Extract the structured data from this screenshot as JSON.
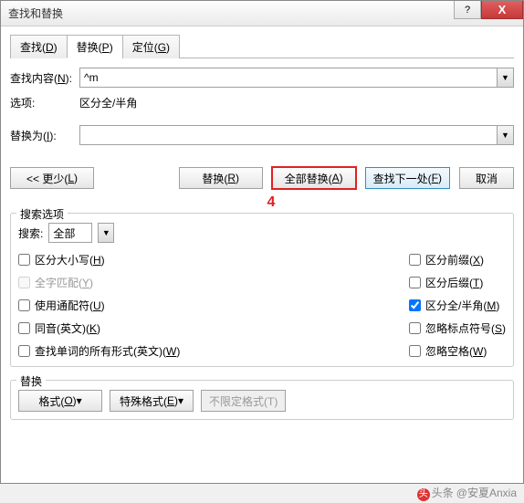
{
  "window": {
    "title": "查找和替换"
  },
  "titlebar_buttons": {
    "help": "?",
    "close": "X"
  },
  "tabs": {
    "find": {
      "label_pre": "查找(",
      "key": "D",
      "label_post": ")"
    },
    "replace": {
      "label_pre": "替换(",
      "key": "P",
      "label_post": ")"
    },
    "goto": {
      "label_pre": "定位(",
      "key": "G",
      "label_post": ")"
    }
  },
  "fields": {
    "find_label_pre": "查找内容(",
    "find_key": "N",
    "find_label_post": "):",
    "find_value": "^m",
    "options_label": "选项:",
    "options_value": "区分全/半角",
    "replace_label_pre": "替换为(",
    "replace_key": "I",
    "replace_label_post": "):",
    "replace_value": ""
  },
  "buttons": {
    "less": "<< 更少(",
    "less_key": "L",
    "less_post": ")",
    "replace": "替换(",
    "replace_key": "R",
    "replace_post": ")",
    "replace_all": "全部替换(",
    "replace_all_key": "A",
    "replace_all_post": ")",
    "find_next": "查找下一处(",
    "find_next_key": "F",
    "find_next_post": ")",
    "cancel": "取消",
    "format": "格式(",
    "format_key": "O",
    "format_post": ")",
    "special": "特殊格式(",
    "special_key": "E",
    "special_post": ")",
    "noformat": "不限定格式(T)"
  },
  "annotation": "4",
  "groups": {
    "search_options": "搜索选项",
    "replace_group": "替换"
  },
  "search_dir": {
    "label": "搜索:",
    "value": "全部"
  },
  "checkboxes_left": [
    {
      "pre": "区分大小写(",
      "key": "H",
      "post": ")",
      "checked": false,
      "disabled": false
    },
    {
      "pre": "全字匹配(",
      "key": "Y",
      "post": ")",
      "checked": false,
      "disabled": true
    },
    {
      "pre": "使用通配符(",
      "key": "U",
      "post": ")",
      "checked": false,
      "disabled": false
    },
    {
      "pre": "同音(英文)(",
      "key": "K",
      "post": ")",
      "checked": false,
      "disabled": false
    },
    {
      "pre": "查找单词的所有形式(英文)(",
      "key": "W",
      "post": ")",
      "checked": false,
      "disabled": false
    }
  ],
  "checkboxes_right": [
    {
      "pre": "区分前缀(",
      "key": "X",
      "post": ")",
      "checked": false,
      "disabled": false
    },
    {
      "pre": "区分后缀(",
      "key": "T",
      "post": ")",
      "checked": false,
      "disabled": false
    },
    {
      "pre": "区分全/半角(",
      "key": "M",
      "post": ")",
      "checked": true,
      "disabled": false
    },
    {
      "pre": "忽略标点符号(",
      "key": "S",
      "post": ")",
      "checked": false,
      "disabled": false
    },
    {
      "pre": "忽略空格(",
      "key": "W",
      "post": ")",
      "checked": false,
      "disabled": false
    }
  ],
  "watermark": {
    "source": "头条",
    "author": "@安夏Anxia"
  }
}
